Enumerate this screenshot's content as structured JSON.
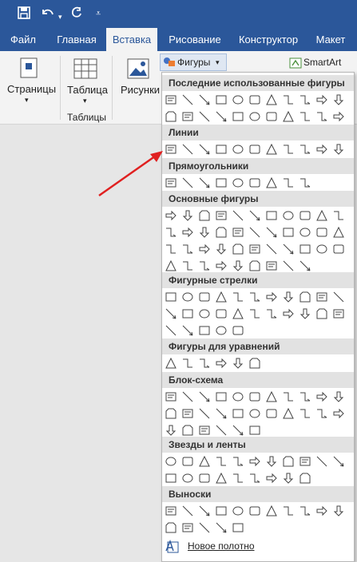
{
  "ribbon_tabs": [
    "Файл",
    "Главная",
    "Вставка",
    "Рисование",
    "Конструктор",
    "Макет"
  ],
  "ribbon": {
    "pages": "Страницы",
    "table": "Таблица",
    "tables_group": "Таблицы",
    "pictures": "Рисунки",
    "shapes": "Фигуры",
    "smartart": "SmartArt"
  },
  "shapes_menu": {
    "categories": [
      {
        "name": "Последние использованные фигуры",
        "count": 24
      },
      {
        "name": "Линии",
        "count": 12
      },
      {
        "name": "Прямоугольники",
        "count": 9
      },
      {
        "name": "Основные фигуры",
        "count": 42
      },
      {
        "name": "Фигурные стрелки",
        "count": 27
      },
      {
        "name": "Фигуры для уравнений",
        "count": 6
      },
      {
        "name": "Блок-схема",
        "count": 28
      },
      {
        "name": "Звезды и ленты",
        "count": 20
      },
      {
        "name": "Выноски",
        "count": 16
      }
    ],
    "new_canvas": "Новое полотно"
  },
  "colors": {
    "accent": "#2b579a",
    "arrow": "#e02020"
  }
}
